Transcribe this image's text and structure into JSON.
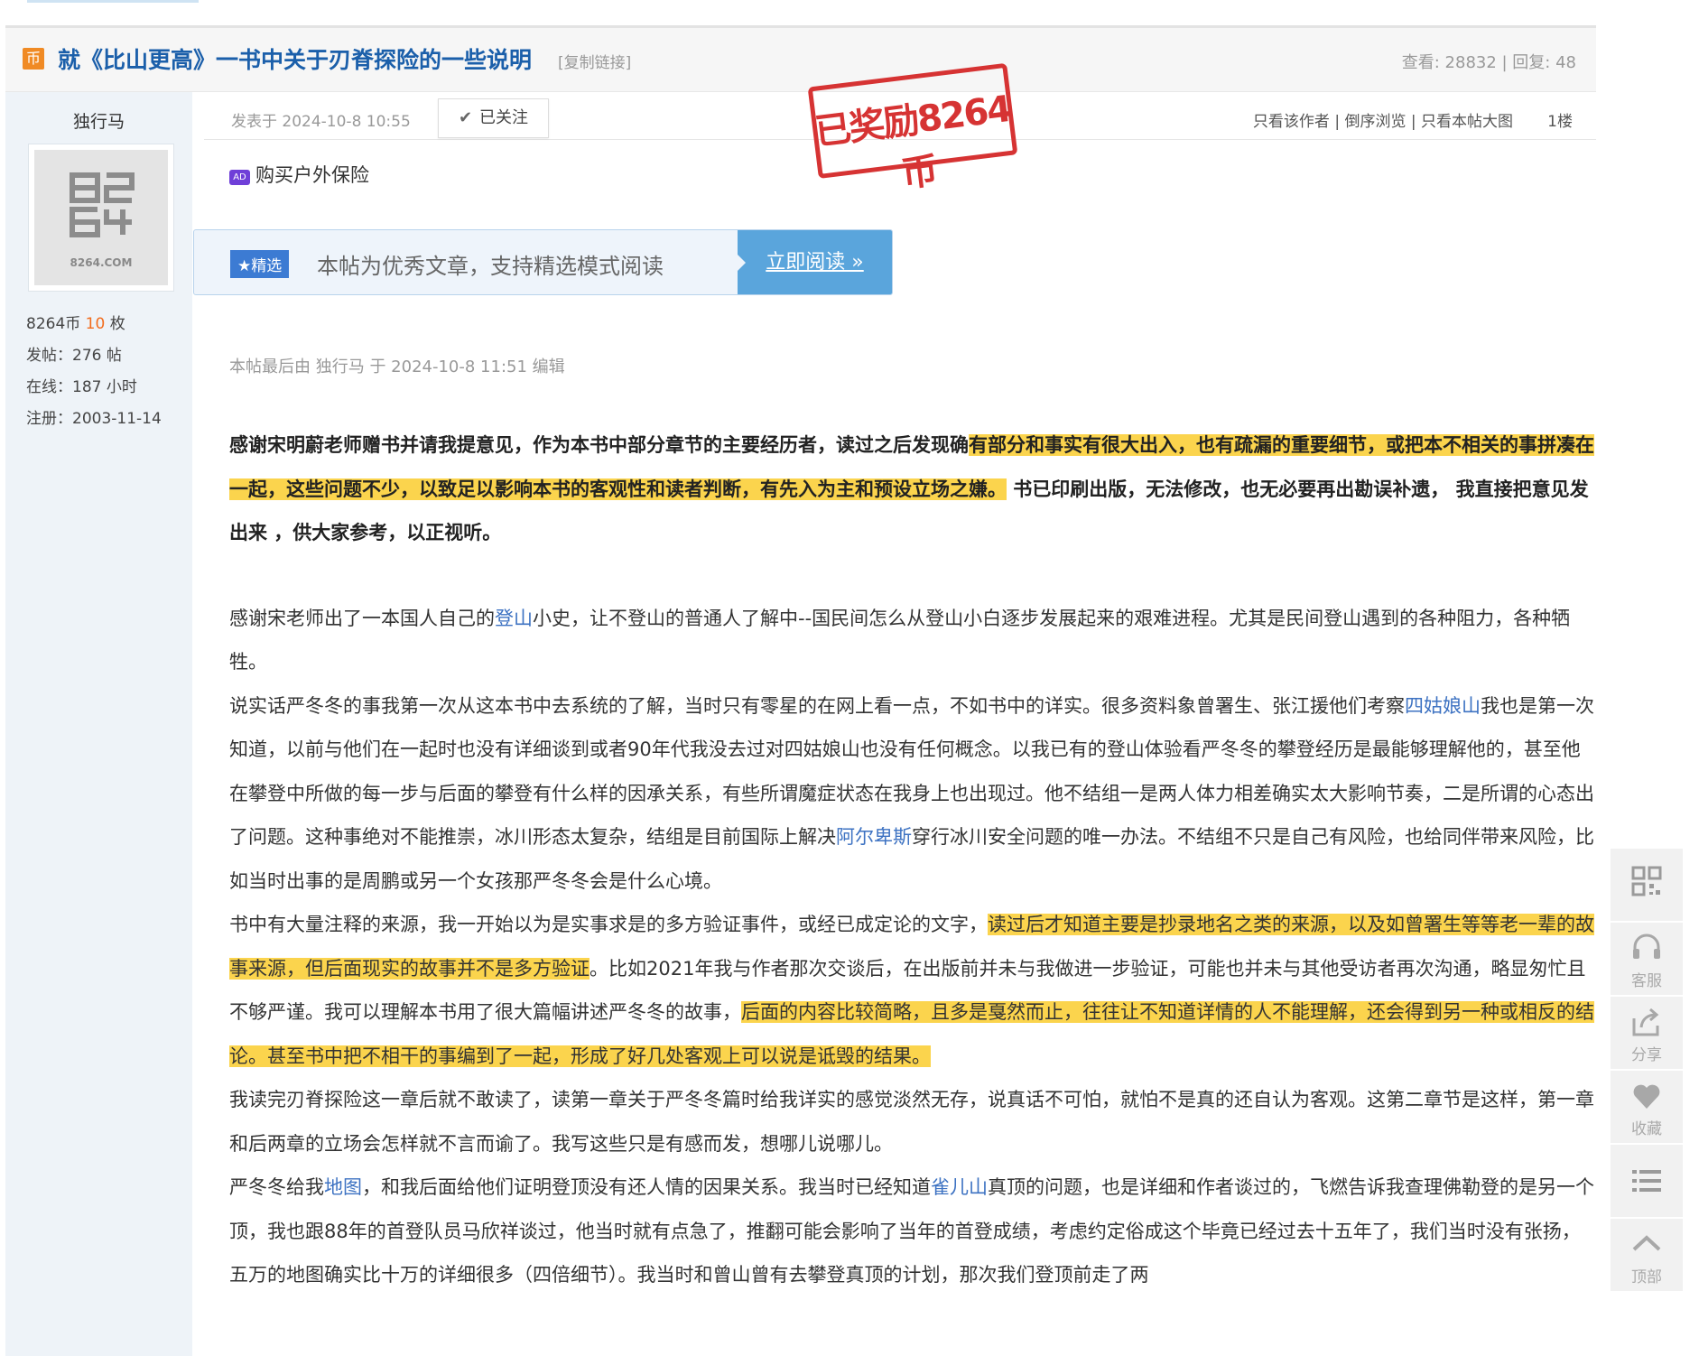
{
  "thread": {
    "coin_icon": "币",
    "title": "就《比山更高》一书中关于刃脊探险的一些说明",
    "copy_link": "[复制链接]",
    "stats": "查看: 28832 | 回复: 48"
  },
  "author": {
    "name": "独行马",
    "avatar_text": "8264.COM",
    "coins_label": "8264币",
    "coins_value": "10",
    "coins_unit": "枚",
    "posts": "发帖：276 帖",
    "online": "在线：187 小时",
    "registered": "注册：2003-11-14"
  },
  "post": {
    "date": "发表于 2024-10-8 10:55",
    "follow_label": "已关注",
    "links": {
      "only_author": "只看该作者",
      "reverse": "倒序浏览",
      "large_images": "只看本帖大图",
      "separator": "|"
    },
    "floor": "1楼",
    "stamp": "已奖励8264币",
    "ad_tag": "AD",
    "ad_text": "购买户外保险",
    "featured_tag": "★精选",
    "featured_text": "本帖为优秀文章，支持精选模式阅读",
    "read_button": "立即阅读 »",
    "edit_note": "本帖最后由 独行马 于 2024-10-8 11:51 编辑"
  },
  "content": {
    "p1_a": "感谢宋明蔚老师赠书并请我提意见，作为本书中部分章节的主要经历者，读过之后发现确",
    "p1_hl": "有部分和事实有很大出入，也有疏漏的重要细节，或把本不相关的事拼凑在一起，这些问题不少，以致足以影响本书的客观性和读者判断，有先入为主和预设立场之嫌。",
    "p1_b": " 书已印刷出版，无法修改，也无必要再出勘误补遗， 我直接把意见发出来 ，供大家参考，以正视听。",
    "p2_a": "感谢宋老师出了一本国人自己的",
    "p2_kw": "登山",
    "p2_b": "小史，让不登山的普通人了解中--国民间怎么从登山小白逐步发展起来的艰难进程。尤其是民间登山遇到的各种阻力，各种牺牲。",
    "p3_a": "说实话严冬冬的事我第一次从这本书中去系统的了解，当时只有零星的在网上看一点，不如书中的详实。很多资料象曾署生、张江援他们考察",
    "p3_kw1": "四姑娘山",
    "p3_b": "我也是第一次知道，以前与他们在一起时也没有详细谈到或者90年代我没去过对四姑娘山也没有任何概念。以我已有的登山体验看严冬冬的攀登经历是最能够理解他的，甚至他在攀登中所做的每一步与后面的攀登有什么样的因承关系，有些所谓魔症状态在我身上也出现过。他不结组一是两人体力相差确实太大影响节奏，二是所谓的心态出了问题。这种事绝对不能推崇，冰川形态太复杂，结组是目前国际上解决",
    "p3_kw2": "阿尔卑斯",
    "p3_c": "穿行冰川安全问题的唯一办法。不结组不只是自己有风险，也给同伴带来风险，比如当时出事的是周鹏或另一个女孩那严冬冬会是什么心境。",
    "p4_a": "书中有大量注释的来源，我一开始以为是实事求是的多方验证事件，或经已成定论的文字，",
    "p4_hl1": "读过后才知道主要是抄录地名之类的来源，以及如曾署生等等老一辈的故事来源，但后面现实的故事并不是多方验证",
    "p4_b": "。比如2021年我与作者那次交谈后，在出版前并未与我做进一步验证，可能也并未与其他受访者再次沟通，略显匆忙且不够严谨。我可以理解本书用了很大篇幅讲述严冬冬的故事，",
    "p4_hl2": "后面的内容比较简略，且多是戛然而止，往往让不知道详情的人不能理解，还会得到另一种或相反的结论。甚至书中把不相干的事编到了一起，形成了好几处客观上可以说是诋毁的结果。",
    "p5": "我读完刃脊探险这一章后就不敢读了，读第一章关于严冬冬篇时给我详实的感觉淡然无存，说真话不可怕，就怕不是真的还自认为客观。这第二章节是这样，第一章和后两章的立场会怎样就不言而谕了。我写这些只是有感而发，想哪儿说哪儿。",
    "p6_a": "严冬冬给我",
    "p6_kw1": "地图",
    "p6_b": "，和我后面给他们证明登顶没有还人情的因果关系。我当时已经知道",
    "p6_kw2": "雀儿山",
    "p6_c": "真顶的问题，也是详细和作者谈过的，飞燃告诉我查理佛勒登的是另一个顶，我也跟88年的首登队员马欣祥谈过，他当时就有点急了，推翻可能会影响了当年的首登成绩，考虑约定俗成这个毕竟已经过去十五年了，我们当时没有张扬，五万的地图确实比十万的详细很多（四倍细节）。我当时和曾山曾有去攀登真顶的计划，那次我们登顶前走了两"
  },
  "sidebar": {
    "qr_icon": "qr-code-icon",
    "service_label": "客服",
    "share_label": "分享",
    "favorite_label": "收藏",
    "list_icon": "list-icon",
    "top_label": "顶部"
  },
  "colors": {
    "title_blue": "#1b5faa",
    "highlight": "#fbd44d",
    "link_blue": "#3d72c2",
    "stamp_red": "#d63333",
    "coin_orange": "#f08a24"
  }
}
